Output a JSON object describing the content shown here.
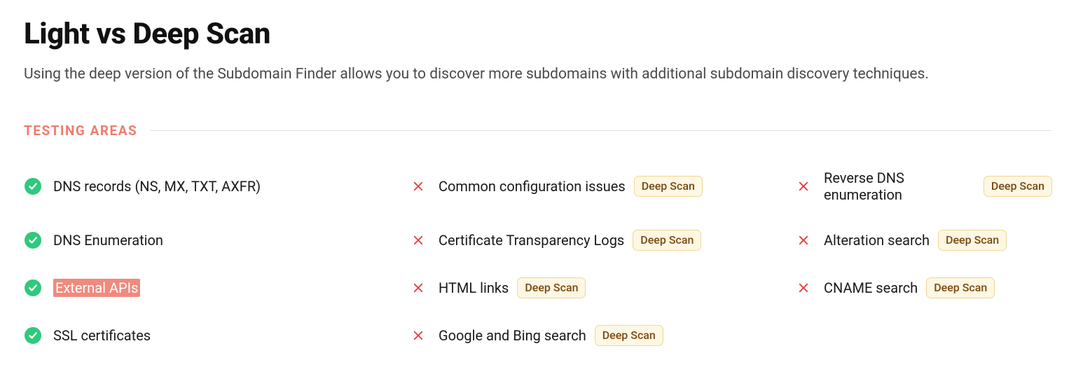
{
  "header": {
    "title": "Light vs Deep Scan",
    "subtitle": "Using the deep version of the Subdomain Finder allows you to discover more subdomains with additional subdomain discovery techniques."
  },
  "section": {
    "label": "TESTING AREAS"
  },
  "badges": {
    "deep_scan": "Deep Scan"
  },
  "colors": {
    "accent_salmon": "#f07b6f",
    "highlight_bg": "#f08a7d",
    "check_green": "#2fc97c",
    "x_red": "#e03e3e",
    "badge_bg": "#fdf7e3",
    "badge_border": "#efd893",
    "badge_text": "#7a4a12"
  },
  "areas": {
    "col1": [
      {
        "label": "DNS records (NS, MX, TXT, AXFR)",
        "included": true,
        "highlighted": false
      },
      {
        "label": "DNS Enumeration",
        "included": true,
        "highlighted": false
      },
      {
        "label": "External APIs",
        "included": true,
        "highlighted": true
      },
      {
        "label": "SSL certificates",
        "included": true,
        "highlighted": false
      }
    ],
    "col2": [
      {
        "label": "Common configuration issues",
        "included": false,
        "badge": "deep_scan"
      },
      {
        "label": "Certificate Transparency Logs",
        "included": false,
        "badge": "deep_scan"
      },
      {
        "label": "HTML links",
        "included": false,
        "badge": "deep_scan"
      },
      {
        "label": "Google and Bing search",
        "included": false,
        "badge": "deep_scan"
      }
    ],
    "col3": [
      {
        "label": "Reverse DNS enumeration",
        "included": false,
        "badge": "deep_scan"
      },
      {
        "label": "Alteration search",
        "included": false,
        "badge": "deep_scan"
      },
      {
        "label": "CNAME search",
        "included": false,
        "badge": "deep_scan"
      }
    ]
  }
}
